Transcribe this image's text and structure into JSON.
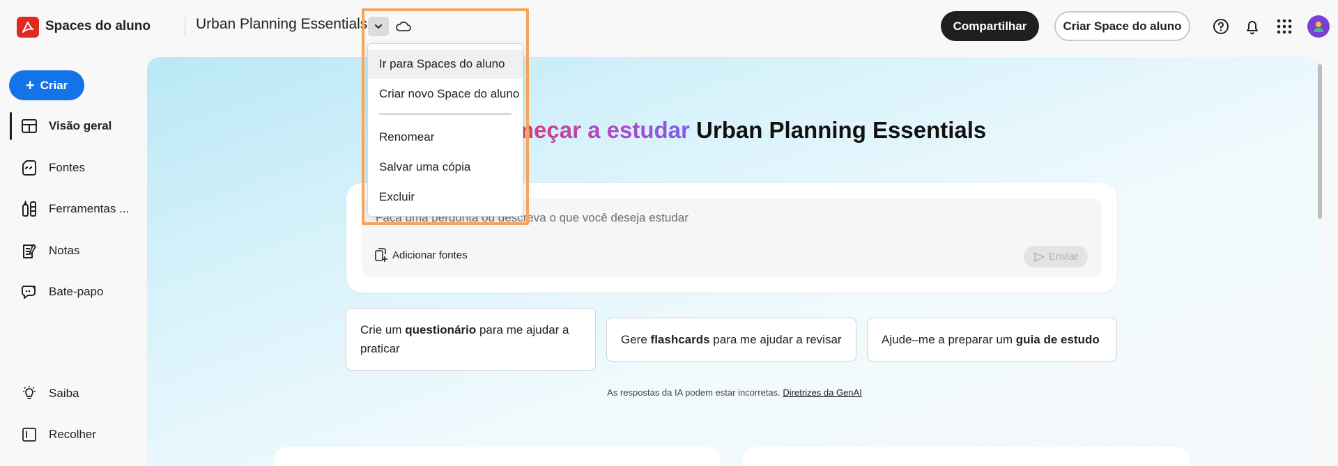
{
  "header": {
    "app_title": "Spaces do aluno",
    "space_title": "Urban Planning Essentials",
    "share_label": "Compartilhar",
    "create_space_label": "Criar Space do aluno"
  },
  "menu": {
    "items": [
      "Ir para Spaces do aluno",
      "Criar novo Space do aluno",
      "Renomear",
      "Salvar uma cópia",
      "Excluir"
    ]
  },
  "sidebar": {
    "create_label": "Criar",
    "items": [
      {
        "label": "Visão geral",
        "icon": "overview-icon"
      },
      {
        "label": "Fontes",
        "icon": "sources-icon"
      },
      {
        "label": "Ferramentas ...",
        "icon": "tools-icon"
      },
      {
        "label": "Notas",
        "icon": "notes-icon"
      },
      {
        "label": "Bate-papo",
        "icon": "chat-icon"
      }
    ],
    "bottom": [
      {
        "label": "Saiba",
        "icon": "lightbulb-icon"
      },
      {
        "label": "Recolher",
        "icon": "collapse-icon"
      }
    ]
  },
  "main": {
    "heading_gradient": "Começar a estudar",
    "heading_rest": "Urban Planning Essentials",
    "prompt_placeholder": "Faça uma pergunta ou descreva o que você deseja estudar",
    "add_sources_label": "Adicionar fontes",
    "send_label": "Enviar",
    "suggestions": [
      {
        "pre": "Crie um ",
        "bold": "questionário",
        "post": " para me ajudar a praticar"
      },
      {
        "pre": "Gere ",
        "bold": "flashcards",
        "post": " para me ajudar a revisar"
      },
      {
        "pre": "Ajude–me a preparar um ",
        "bold": "guia de estudo",
        "post": ""
      }
    ],
    "disclaimer_text": "As respostas da IA podem estar incorretas.",
    "disclaimer_link": "Diretrizes da GenAI"
  },
  "colors": {
    "accent_blue": "#1473e6",
    "brand_red": "#e02a20",
    "highlight_orange": "#f6a45a"
  }
}
